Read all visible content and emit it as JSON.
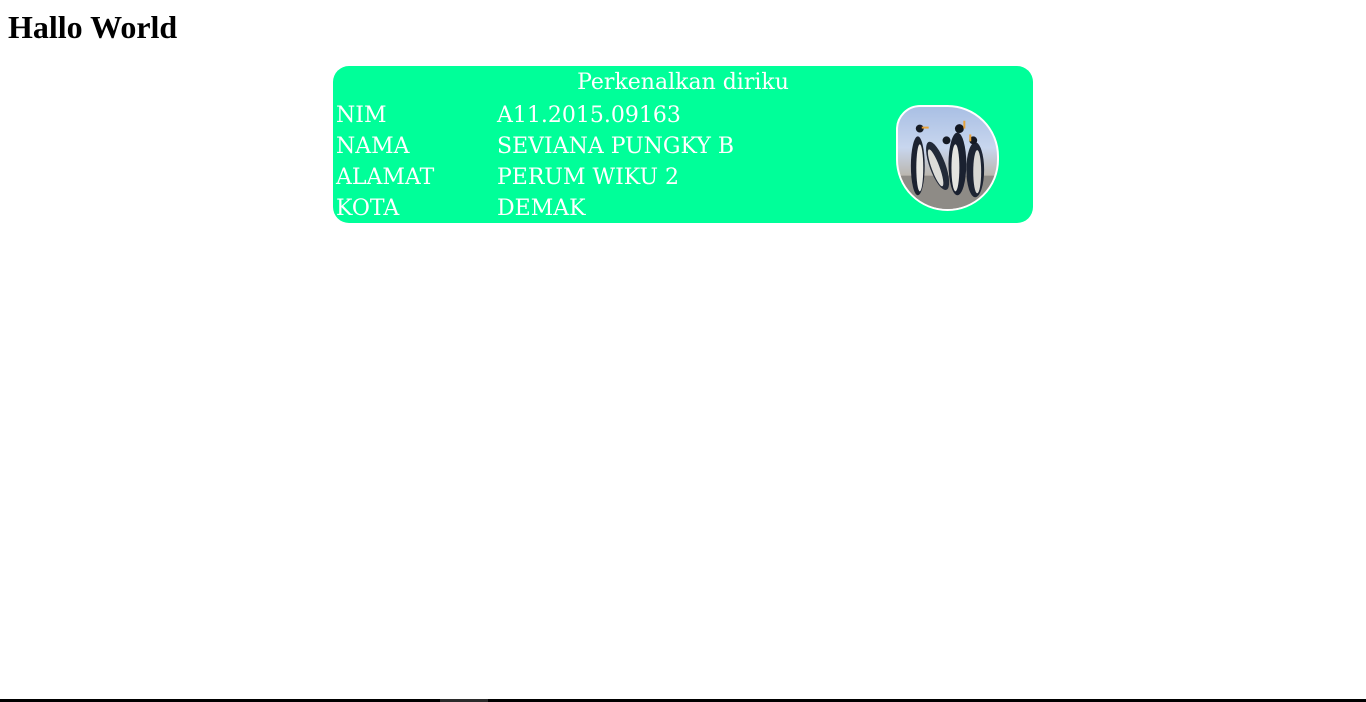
{
  "page": {
    "heading": "Hallo World"
  },
  "card": {
    "heading": "Perkenalkan diriku",
    "rows": [
      {
        "label": "NIM",
        "value": "A11.2015.09163"
      },
      {
        "label": "NAMA",
        "value": "SEVIANA PUNGKY B"
      },
      {
        "label": "ALAMAT",
        "value": "PERUM WIKU 2"
      },
      {
        "label": "KOTA",
        "value": "DEMAK"
      }
    ],
    "photo_icon": "penguins-photo"
  },
  "colors": {
    "card_background": "#00ff99",
    "card_text": "#ffffff",
    "page_background": "#ffffff"
  }
}
